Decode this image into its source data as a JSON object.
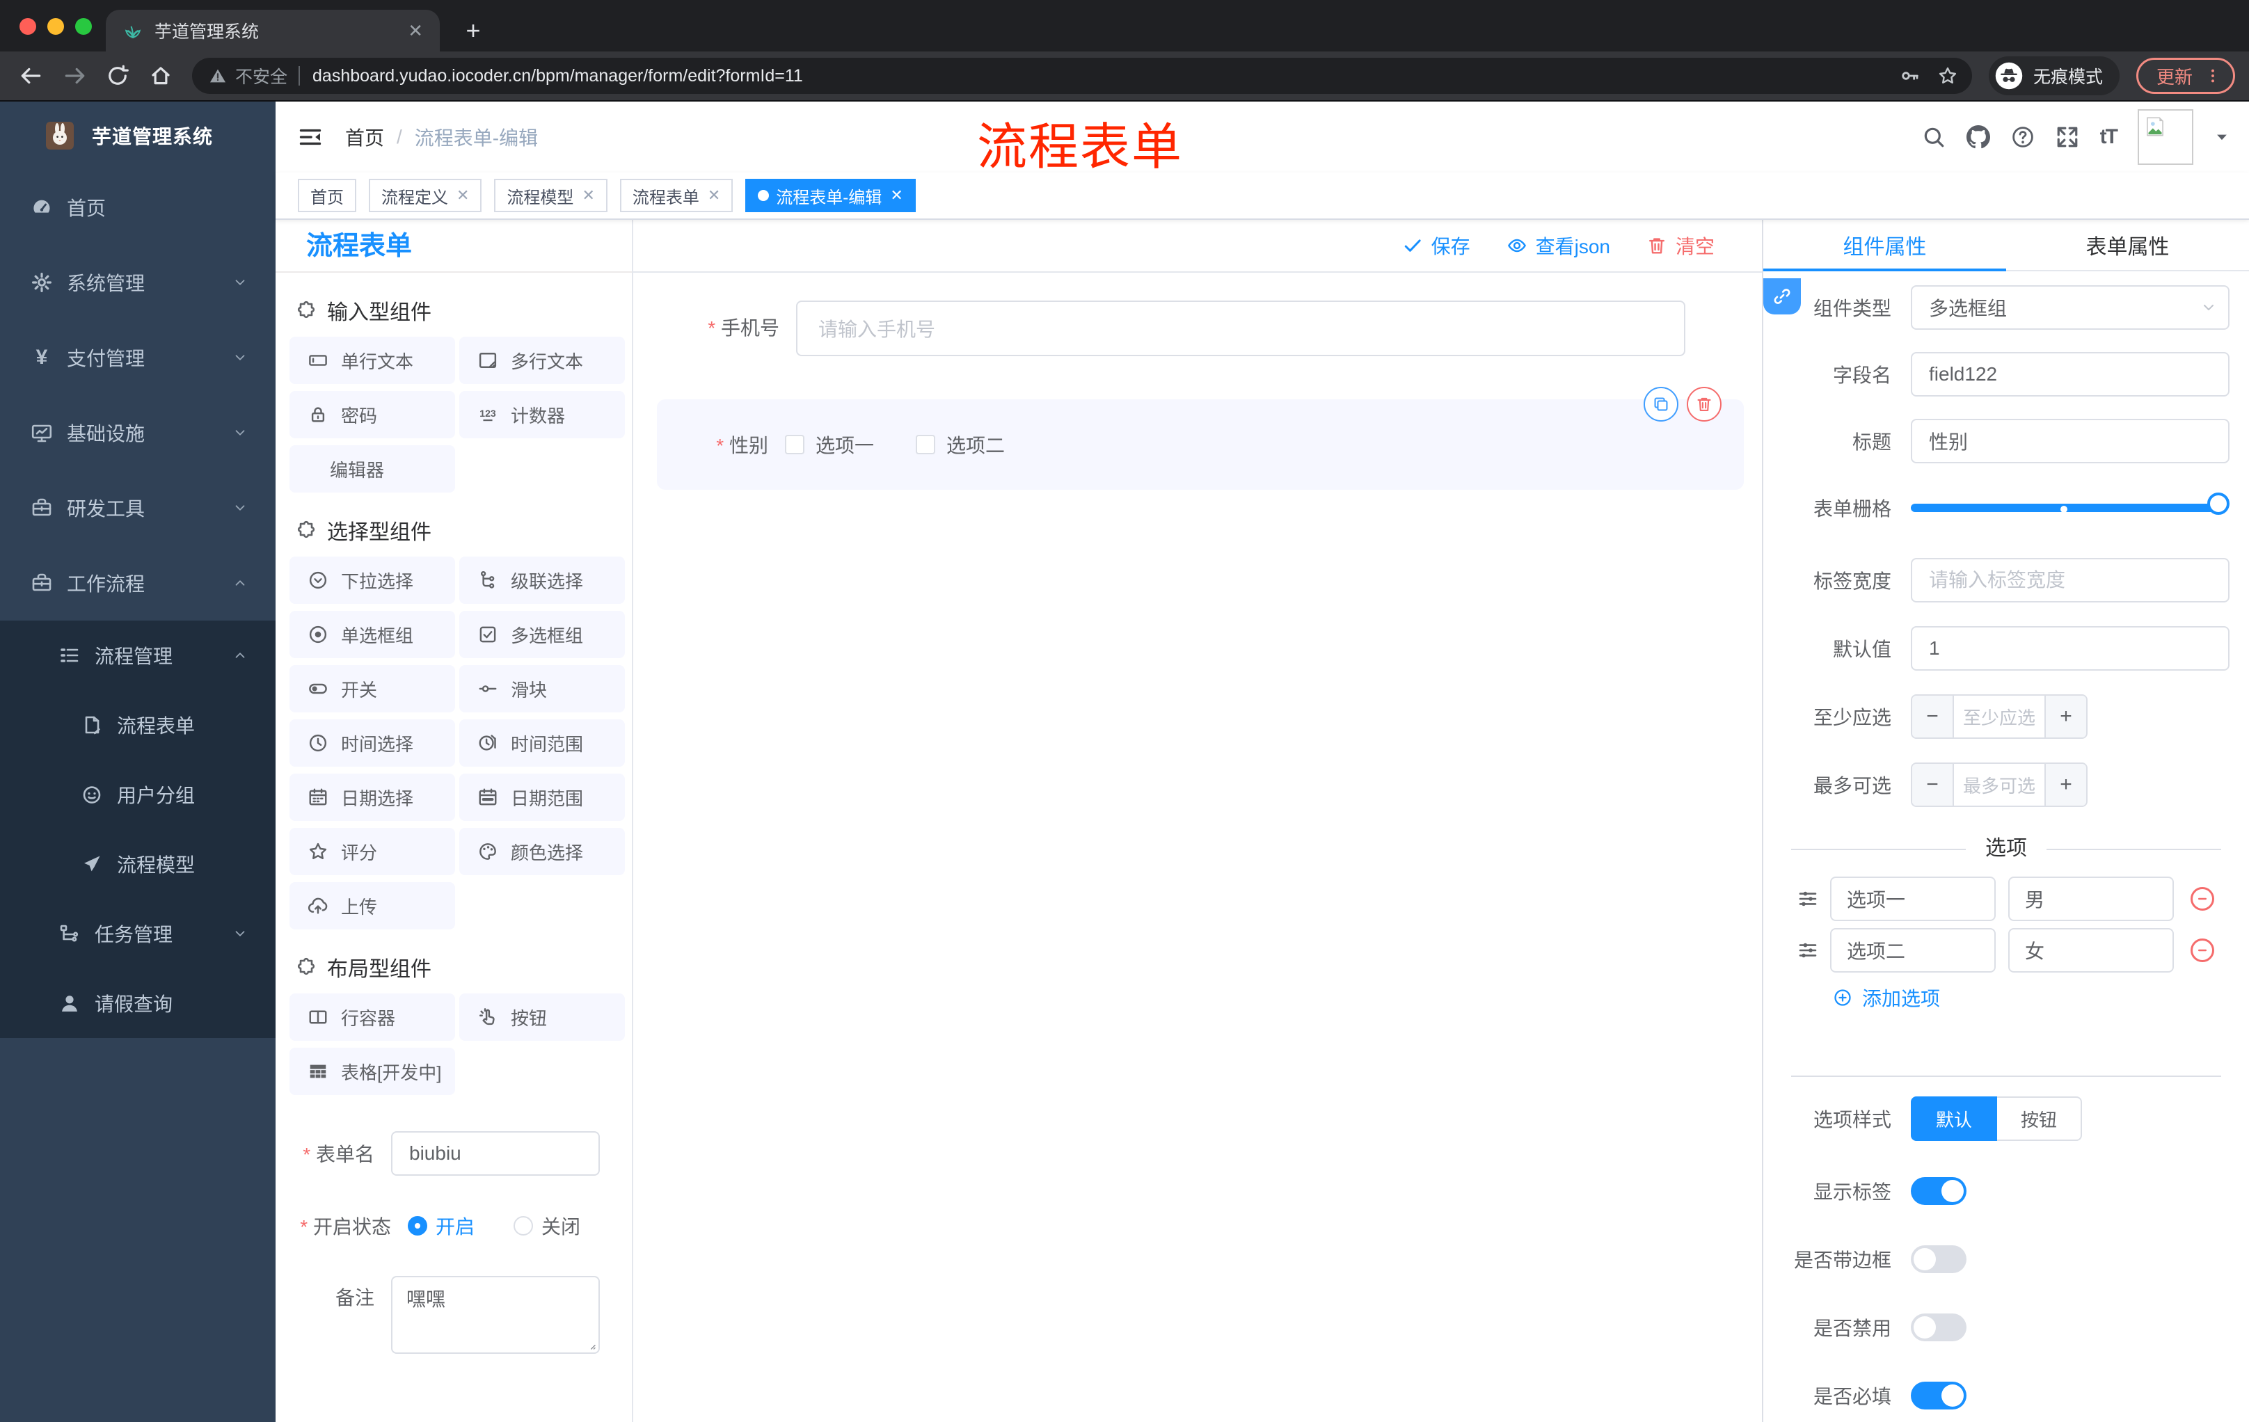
{
  "browser": {
    "tab_title": "芋道管理系统",
    "security_label": "不安全",
    "url": "dashboard.yudao.iocoder.cn/bpm/manager/form/edit?formId=11",
    "incognito_label": "无痕模式",
    "update_label": "更新"
  },
  "annotation": {
    "text": "流程表单",
    "color": "#ff2600"
  },
  "sidebar": {
    "logo_title": "芋道管理系统",
    "items": [
      {
        "icon": "dashboard",
        "label": "首页",
        "level": 1
      },
      {
        "icon": "gear",
        "label": "系统管理",
        "level": 1,
        "chevron": "down"
      },
      {
        "icon": "yen",
        "label": "支付管理",
        "level": 1,
        "chevron": "down"
      },
      {
        "icon": "monitor",
        "label": "基础设施",
        "level": 1,
        "chevron": "down"
      },
      {
        "icon": "toolbox",
        "label": "研发工具",
        "level": 1,
        "chevron": "down"
      },
      {
        "icon": "briefcase",
        "label": "工作流程",
        "level": 1,
        "chevron": "up"
      }
    ],
    "submenu_items": [
      {
        "icon": "list-tree",
        "label": "流程管理",
        "level": 2,
        "chevron": "up"
      },
      {
        "icon": "document-edit",
        "label": "流程表单",
        "level": 3
      },
      {
        "icon": "robot",
        "label": "用户分组",
        "level": 3
      },
      {
        "icon": "paper-plane",
        "label": "流程模型",
        "level": 3
      },
      {
        "icon": "org-tree",
        "label": "任务管理",
        "level": 2,
        "chevron": "down"
      },
      {
        "icon": "user",
        "label": "请假查询",
        "level": 2
      }
    ]
  },
  "header": {
    "breadcrumb": {
      "home": "首页",
      "current": "流程表单-编辑"
    }
  },
  "tags": [
    {
      "label": "首页",
      "closable": false,
      "active": false
    },
    {
      "label": "流程定义",
      "closable": true,
      "active": false
    },
    {
      "label": "流程模型",
      "closable": true,
      "active": false
    },
    {
      "label": "流程表单",
      "closable": true,
      "active": false
    },
    {
      "label": "流程表单-编辑",
      "closable": true,
      "active": true
    }
  ],
  "palette": {
    "title": "流程表单",
    "sections": [
      {
        "title": "输入型组件",
        "items": [
          {
            "icon": "input",
            "label": "单行文本"
          },
          {
            "icon": "textarea",
            "label": "多行文本"
          },
          {
            "icon": "lock",
            "label": "密码"
          },
          {
            "icon": "counter",
            "label": "计数器"
          },
          {
            "icon": null,
            "label": "编辑器"
          }
        ]
      },
      {
        "title": "选择型组件",
        "items": [
          {
            "icon": "select",
            "label": "下拉选择"
          },
          {
            "icon": "cascader",
            "label": "级联选择"
          },
          {
            "icon": "radio",
            "label": "单选框组"
          },
          {
            "icon": "checkbox",
            "label": "多选框组"
          },
          {
            "icon": "switch",
            "label": "开关"
          },
          {
            "icon": "slider",
            "label": "滑块"
          },
          {
            "icon": "time",
            "label": "时间选择"
          },
          {
            "icon": "time-range",
            "label": "时间范围"
          },
          {
            "icon": "date",
            "label": "日期选择"
          },
          {
            "icon": "date-range",
            "label": "日期范围"
          },
          {
            "icon": "star",
            "label": "评分"
          },
          {
            "icon": "color",
            "label": "颜色选择"
          },
          {
            "icon": "upload",
            "label": "上传"
          }
        ]
      },
      {
        "title": "布局型组件",
        "items": [
          {
            "icon": "row",
            "label": "行容器"
          },
          {
            "icon": "button",
            "label": "按钮"
          },
          {
            "icon": "table",
            "label": "表格[开发中]"
          }
        ]
      }
    ],
    "form": {
      "name_label": "表单名",
      "name_value": "biubiu",
      "status_label": "开启状态",
      "status_on": "开启",
      "status_off": "关闭",
      "remark_label": "备注",
      "remark_value": "嘿嘿"
    }
  },
  "canvas": {
    "save_label": "保存",
    "view_json_label": "查看json",
    "clear_label": "清空",
    "phone_field": {
      "label": "手机号",
      "placeholder": "请输入手机号"
    },
    "gender_field": {
      "label": "性别",
      "options": [
        "选项一",
        "选项二"
      ]
    }
  },
  "props": {
    "tab_component": "组件属性",
    "tab_form": "表单属性",
    "component_type": {
      "label": "组件类型",
      "value": "多选框组"
    },
    "field_name": {
      "label": "字段名",
      "value": "field122"
    },
    "title": {
      "label": "标题",
      "value": "性别"
    },
    "grid": {
      "label": "表单栅格"
    },
    "label_width": {
      "label": "标签宽度",
      "placeholder": "请输入标签宽度"
    },
    "default_value": {
      "label": "默认值",
      "value": "1"
    },
    "min_select": {
      "label": "至少应选",
      "placeholder": "至少应选"
    },
    "max_select": {
      "label": "最多可选",
      "placeholder": "最多可选"
    },
    "options_title": "选项",
    "options": [
      {
        "label": "选项一",
        "value": "男"
      },
      {
        "label": "选项二",
        "value": "女"
      }
    ],
    "add_option_label": "添加选项",
    "option_style": {
      "label": "选项样式",
      "choices": [
        "默认",
        "按钮"
      ],
      "active": "默认"
    },
    "toggles": [
      {
        "label": "显示标签",
        "on": true
      },
      {
        "label": "是否带边框",
        "on": false
      },
      {
        "label": "是否禁用",
        "on": false
      },
      {
        "label": "是否必填",
        "on": true
      }
    ]
  },
  "colors": {
    "accent": "#1890ff",
    "element_blue": "#409eff",
    "danger": "#f56c6c",
    "sidebar_bg": "#304156",
    "submenu_bg": "#1f2d3d",
    "annotation_red": "#ff2600"
  }
}
